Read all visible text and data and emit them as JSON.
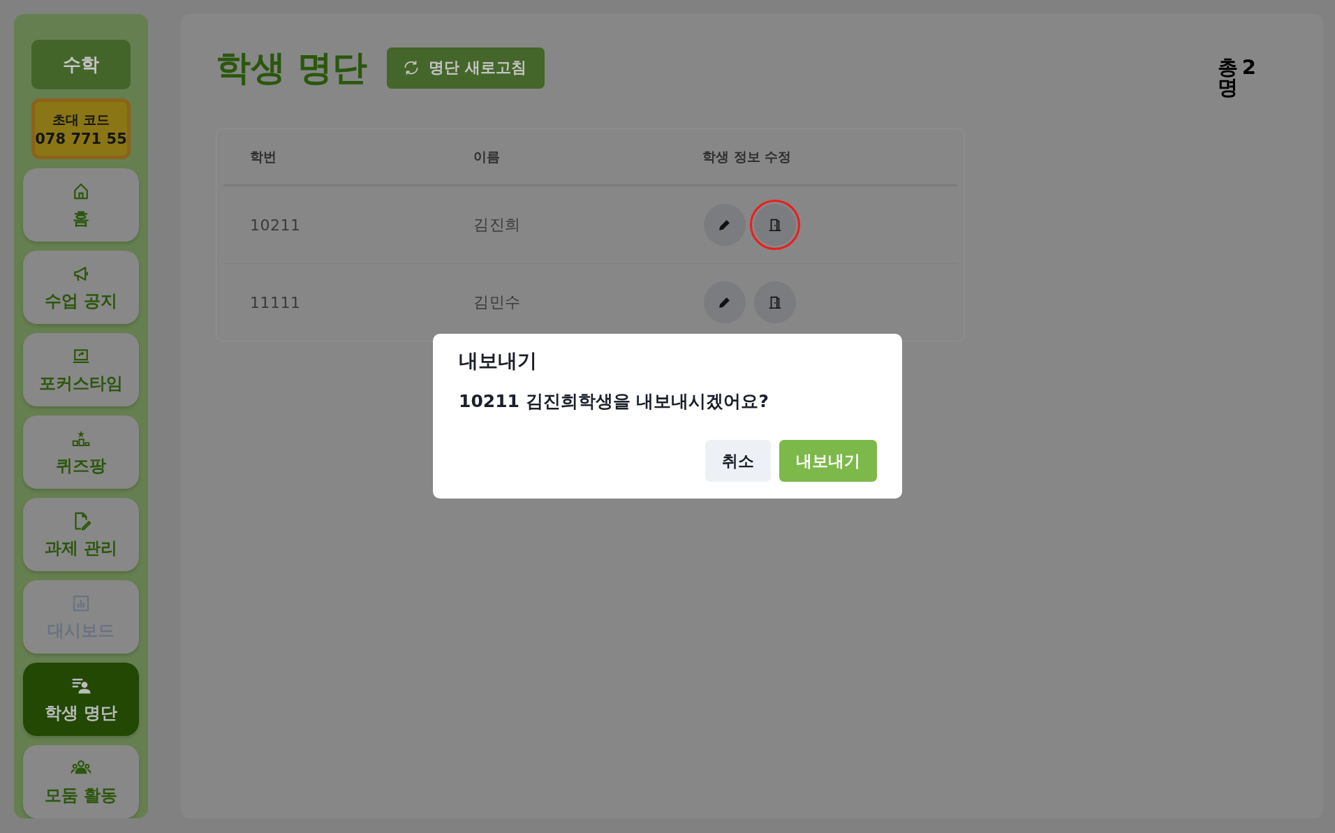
{
  "sidebar": {
    "subject": "수학",
    "invite_code": {
      "label": "초대 코드",
      "code": "078 771 55"
    },
    "items": [
      {
        "label": "홈",
        "selected": false,
        "disabled": false
      },
      {
        "label": "수업 공지",
        "selected": false,
        "disabled": false
      },
      {
        "label": "포커스타임",
        "selected": false,
        "disabled": false
      },
      {
        "label": "퀴즈팡",
        "selected": false,
        "disabled": false
      },
      {
        "label": "과제 관리",
        "selected": false,
        "disabled": false
      },
      {
        "label": "대시보드",
        "selected": false,
        "disabled": true
      },
      {
        "label": "학생 명단",
        "selected": true,
        "disabled": false
      },
      {
        "label": "모둠 활동",
        "selected": false,
        "disabled": false
      }
    ]
  },
  "page": {
    "title": "학생 명단",
    "refresh_button": "명단 새로고침",
    "total": {
      "prefix": "총",
      "count": "2",
      "suffix": "명"
    }
  },
  "table": {
    "columns": [
      "학번",
      "이름",
      "학생 정보 수정"
    ],
    "rows": [
      {
        "student_id": "10211",
        "name": "김진희",
        "exit_highlighted": true
      },
      {
        "student_id": "11111",
        "name": "김민수",
        "exit_highlighted": false
      }
    ]
  },
  "dialog": {
    "title": "내보내기",
    "message": "10211 김진희학생을 내보내시겠어요?",
    "buttons": [
      {
        "label": "취소",
        "kind": "secondary"
      },
      {
        "label": "내보내기",
        "kind": "primary"
      }
    ]
  }
}
